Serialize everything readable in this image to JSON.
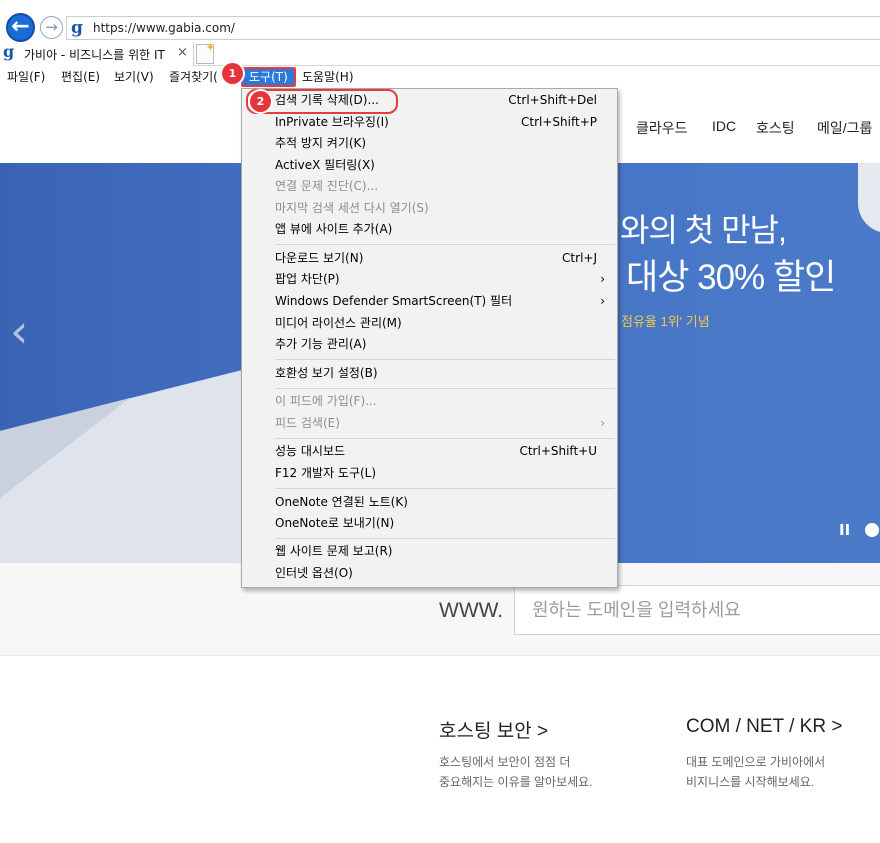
{
  "browser": {
    "url": "https://www.gabia.com/",
    "tab_title": "가비아 - 비즈니스를 위한 IT",
    "tab_close": "×",
    "logo_letter": "g",
    "back_icon": "←",
    "forward_icon": "→"
  },
  "menubar": {
    "items": [
      "파일(F)",
      "편집(E)",
      "보기(V)",
      "즐겨찾기(",
      "도구(T)",
      "도움말(H)"
    ]
  },
  "badges": [
    "1",
    "2"
  ],
  "tools_menu": {
    "items": [
      {
        "label": "검색 기록 삭제(D)...",
        "shortcut": "Ctrl+Shift+Del"
      },
      {
        "label": "InPrivate 브라우징(I)",
        "shortcut": "Ctrl+Shift+P"
      },
      {
        "label": "추적 방지 켜기(K)",
        "shortcut": ""
      },
      {
        "label": "ActiveX 필터링(X)",
        "shortcut": ""
      },
      {
        "label": "연결 문제 진단(C)...",
        "shortcut": ""
      },
      {
        "label": "마지막 검색 세션 다시 열기(S)",
        "shortcut": ""
      },
      {
        "label": "앱 뷰에 사이트 추가(A)",
        "shortcut": ""
      },
      {
        "label": "다운로드 보기(N)",
        "shortcut": "Ctrl+J"
      },
      {
        "label": "팝업 차단(P)",
        "shortcut": ""
      },
      {
        "label": "Windows Defender SmartScreen(T) 필터",
        "shortcut": ""
      },
      {
        "label": "미디어 라이선스 관리(M)",
        "shortcut": ""
      },
      {
        "label": "추가 기능 관리(A)",
        "shortcut": ""
      },
      {
        "label": "호환성 보기 설정(B)",
        "shortcut": ""
      },
      {
        "label": "이 피드에 가입(F)...",
        "shortcut": ""
      },
      {
        "label": "피드 검색(E)",
        "shortcut": ""
      },
      {
        "label": "성능 대시보드",
        "shortcut": "Ctrl+Shift+U"
      },
      {
        "label": "F12 개발자 도구(L)",
        "shortcut": ""
      },
      {
        "label": "OneNote 연결된 노트(K)",
        "shortcut": ""
      },
      {
        "label": "OneNote로 보내기(N)",
        "shortcut": ""
      },
      {
        "label": "웹 사이트 문제 보고(R)",
        "shortcut": ""
      },
      {
        "label": "인터넷 옵션(O)",
        "shortcut": ""
      }
    ],
    "submenu_arrow": "›"
  },
  "site": {
    "nav": [
      "클라우드",
      "IDC",
      "호스팅",
      "메일/그룹"
    ],
    "banner": {
      "line1": "와의 첫 만남,",
      "line2": "대상 30% 할인",
      "sub": "점유율 1위' 기념",
      "prev_icon": "‹",
      "pause_icon": "II"
    },
    "domain_search": {
      "prefix": "WWW.",
      "placeholder": "원하는 도메인을 입력하세요"
    },
    "promos": [
      {
        "title": "호스팅 보안 >",
        "desc1": "호스팅에서 보안이 점점 더",
        "desc2": "중요해지는 이유를 알아보세요."
      },
      {
        "title": "COM / NET / KR >",
        "desc1": "대표 도메인으로 가비아에서",
        "desc2": "비지니스를 시작해보세요."
      }
    ]
  },
  "colors": {
    "accent_blue": "#2b79d8",
    "badge_red": "#e5353a",
    "banner_blue": "#4673c4",
    "banner_sub_yellow": "#f3c84b"
  }
}
